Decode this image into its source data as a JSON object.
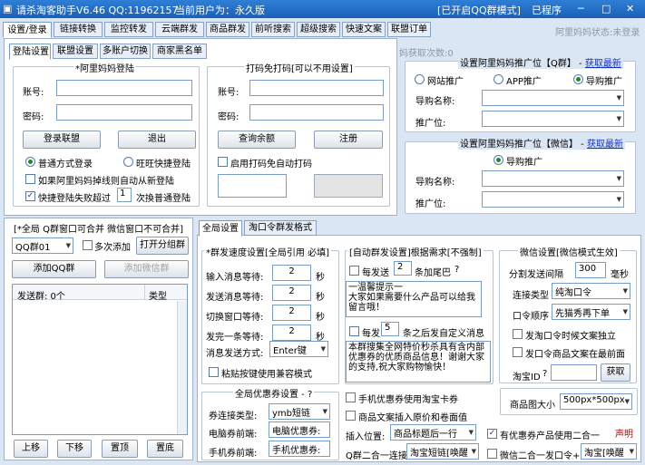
{
  "titlebar": {
    "title": "请杀淘客助手V6.46 QQ:11962157",
    "user": "当前用户为：永久版",
    "qq_mode": "[已开启QQ群模式]",
    "mini_label": "已程序"
  },
  "main_tabs": [
    "设置/登录",
    "链接转换",
    "监控转发",
    "云端群发",
    "商品群发",
    "前听搜索",
    "超级搜索",
    "快速文案",
    "联盟订单"
  ],
  "status_right": "阿里妈妈状态:未登录",
  "login_tabs": [
    "登陆设置",
    "联盟设置",
    "多账户切换",
    "商家黑名单"
  ],
  "alimama": {
    "title": "*阿里妈妈登陆",
    "account_label": "账号:",
    "password_label": "密码:",
    "login_btn": "登录联盟",
    "logout_btn": "退出",
    "radio_normal": "普通方式登录",
    "radio_wangwang": "旺旺快捷登陆",
    "cb_relogin": "如果阿里妈妈掉线则自动从新登陆",
    "cb_fast_prefix": "快捷登陆失败超过",
    "cb_fast_value": "1",
    "cb_fast_suffix": "次換普通登陆"
  },
  "captcha": {
    "title": "打码免打码[可以不用设置]",
    "account_label": "账号:",
    "password_label": "密码:",
    "query_btn": "查询余额",
    "register_btn": "注册",
    "cb_auto": "启用打码免自动打码"
  },
  "fetch_count": "妈获取次数:0",
  "qq_pid": {
    "title": "设置阿里妈妈推广位【Q群】",
    "link": "获取最新",
    "radios": [
      "网站推广",
      "APP推广",
      "导购推广"
    ],
    "guide_label": "导购名称:",
    "pid_label": "推广位:"
  },
  "wx_pid": {
    "title": "设置阿里妈妈推广位【微信】",
    "link": "获取最新",
    "radio": "导购推广",
    "guide_label": "导购名称:",
    "pid_label": "推广位:"
  },
  "groups": {
    "title": "[*全局 Q群窗口可合并 微信窗口不可合并]",
    "select": "QQ群01",
    "cb_multi": "多次添加",
    "open_btn": "打开分组群",
    "add_qq_btn": "添加QQ群",
    "add_wx_btn": "添加微信群",
    "col_group": "发送群: 0个",
    "col_type": "类型",
    "up_btn": "上移",
    "down_btn": "下移",
    "top_btn": "置顶",
    "bottom_btn": "置底"
  },
  "settings_tabs": [
    "全局设置",
    "淘口令群发格式"
  ],
  "speed": {
    "title": "*群发速度设置[全局引用 必填]",
    "rows": [
      {
        "label": "输入消息等待:",
        "value": "2",
        "unit": "秒"
      },
      {
        "label": "发送消息等待:",
        "value": "2",
        "unit": "秒"
      },
      {
        "label": "切换窗口等待:",
        "value": "2",
        "unit": "秒"
      },
      {
        "label": "发完一条等待:",
        "value": "2",
        "unit": "秒"
      }
    ],
    "mode_label": "消息发送方式:",
    "mode_value": "Enter键",
    "cb_paste": "粘贴按键使用兼容模式"
  },
  "auto": {
    "title": "[自动群发设置]根据需求[不强制]",
    "cb1_prefix": "每发送",
    "cb1_value": "2",
    "cb1_suffix": "条加尾巴",
    "help": "?",
    "text1": "一温馨提示一\n大家如果需要什么产品可以给我留言哦！",
    "cb2_prefix": "每发",
    "cb2_value": "5",
    "cb2_suffix": "条之后发自定义消息",
    "text2": "本群搜集全网特价秒杀具有含内部优惠券的优质商品信息！谢谢大家的支持,祝大家购物愉快！"
  },
  "wechat": {
    "title": "微信设置[微信模式生效]",
    "interval_label": "分割发送间隔",
    "interval_value": "300",
    "interval_unit": "毫秒",
    "link_type_label": "连接类型",
    "link_type_value": "纯淘口令",
    "order_label": "口令顺序",
    "order_value": "先猫秀再下单",
    "cb_single": "发淘口令时候文案独立",
    "cb_last": "发口令商品文案在最前面",
    "taobao_id_label": "淘宝ID",
    "taobao_id_help": "?",
    "fetch_btn": "获取"
  },
  "coupon": {
    "title": "全局优惠券设置",
    "help": "?",
    "type_label": "券连接类型:",
    "type_value": "ymb短链",
    "pc_label": "电脑券前端:",
    "pc_value": "电脑优惠券:",
    "mobile_label": "手机券前端:",
    "mobile_value": "手机优惠券:"
  },
  "bottom": {
    "cb_mobile": "手机优惠券使用淘宝卡券",
    "cb_original": "商品文案插入原价和卷面值",
    "insert_label": "插入位置:",
    "insert_value": "商品标题后一行",
    "cb_merge": "有优惠券产品使用二合一",
    "info_link": "声明",
    "q_merge_label": "Q群二合一连接",
    "q_merge_value": "淘宝短链[唤醒",
    "cb_wx_merge": "微信二合一发口令+",
    "wx_merge_value": "淘宝[唤醒",
    "img_size_label": "商品图大小",
    "img_size_value": "500px*500px"
  },
  "colors": {
    "title_bg": "#1a5fb8",
    "window_bg": "#dbe6f4",
    "link": "#1133cc",
    "accent_red": "#c00000"
  }
}
